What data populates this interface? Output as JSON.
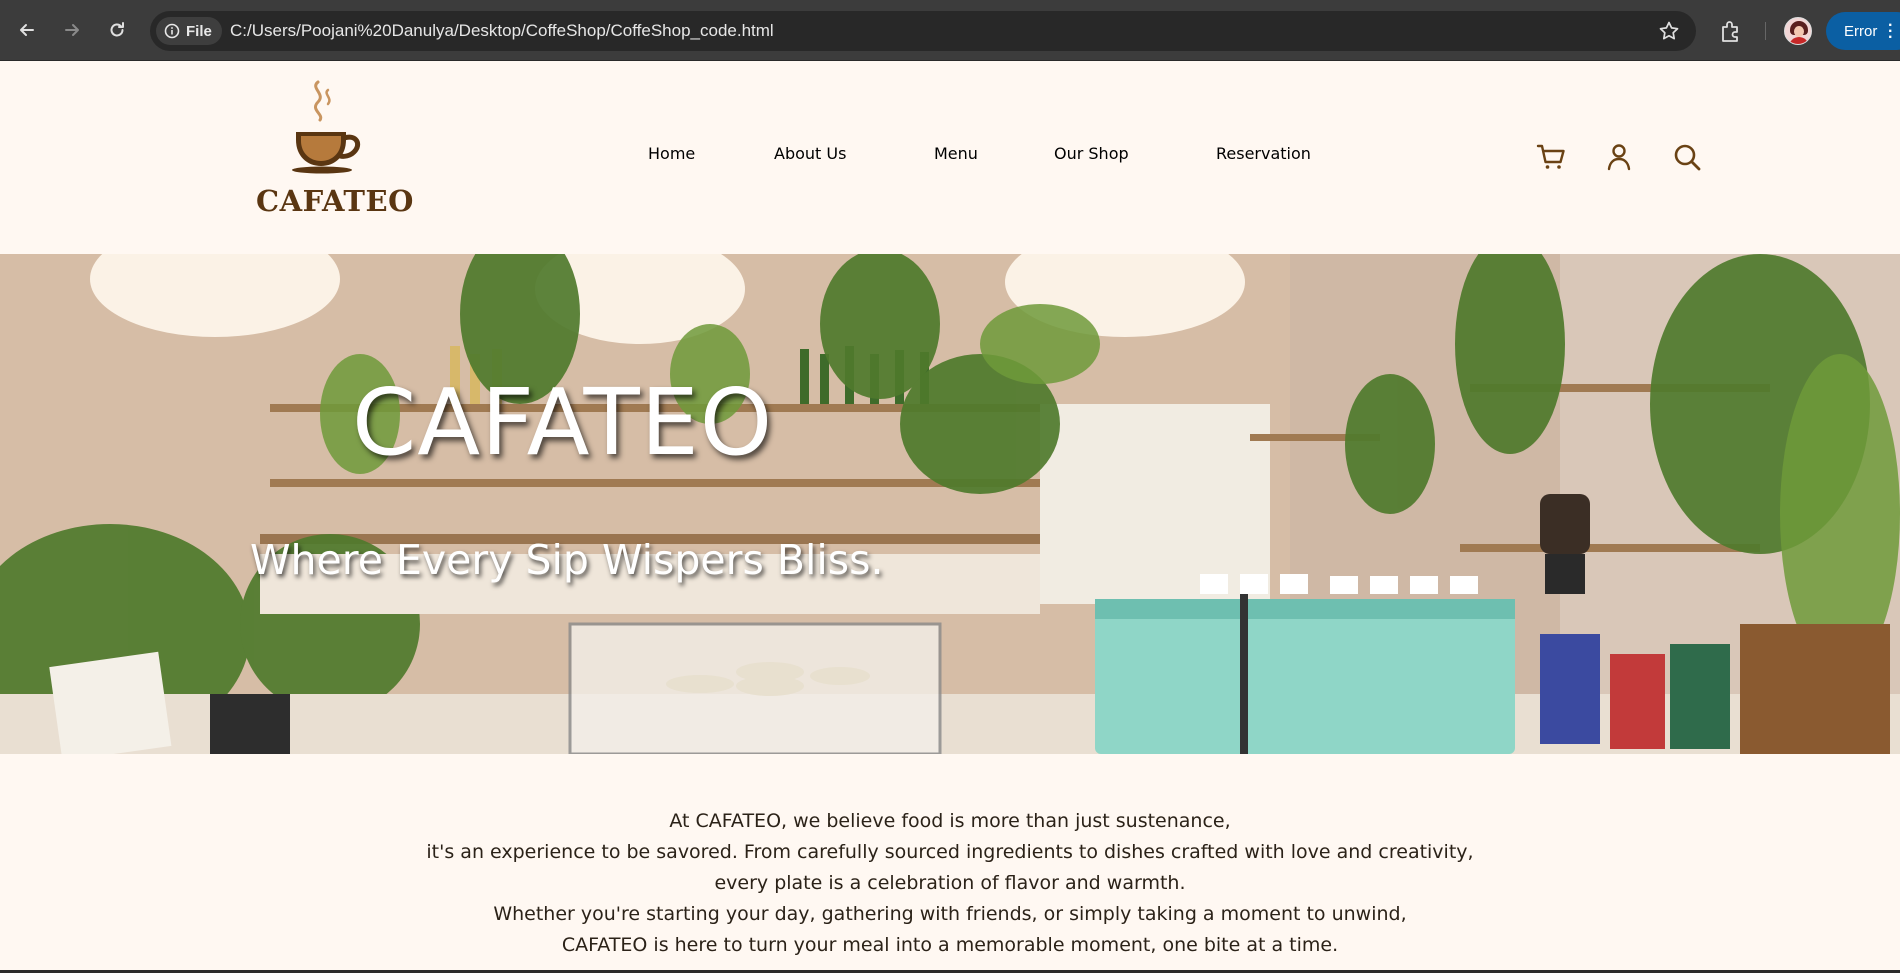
{
  "browser": {
    "file_label": "File",
    "url": "C:/Users/Poojani%20Danulya/Desktop/CoffeShop/CoffeShop_code.html",
    "profile_status": "Error"
  },
  "site": {
    "logo_text": "CAFATEO",
    "nav": [
      "Home",
      "About Us",
      "Menu",
      "Our Shop",
      "Reservation"
    ],
    "header_icons": [
      "cart-icon",
      "user-icon",
      "search-icon"
    ],
    "colors": {
      "brand_brown": "#6a4214",
      "background": "#fff8f2"
    }
  },
  "hero": {
    "title": "CAFATEO",
    "subtitle": "Where Every Sip Wispers Bliss."
  },
  "intro": {
    "lines": [
      "At CAFATEO, we believe food is more than just sustenance,",
      "it's an experience to be savored. From carefully sourced ingredients to dishes crafted with love and creativity,",
      "every plate is a celebration of flavor and warmth.",
      "Whether you're starting your day, gathering with friends, or simply taking a moment to unwind,",
      "CAFATEO is here to turn your meal into a memorable moment, one bite at a time."
    ]
  }
}
